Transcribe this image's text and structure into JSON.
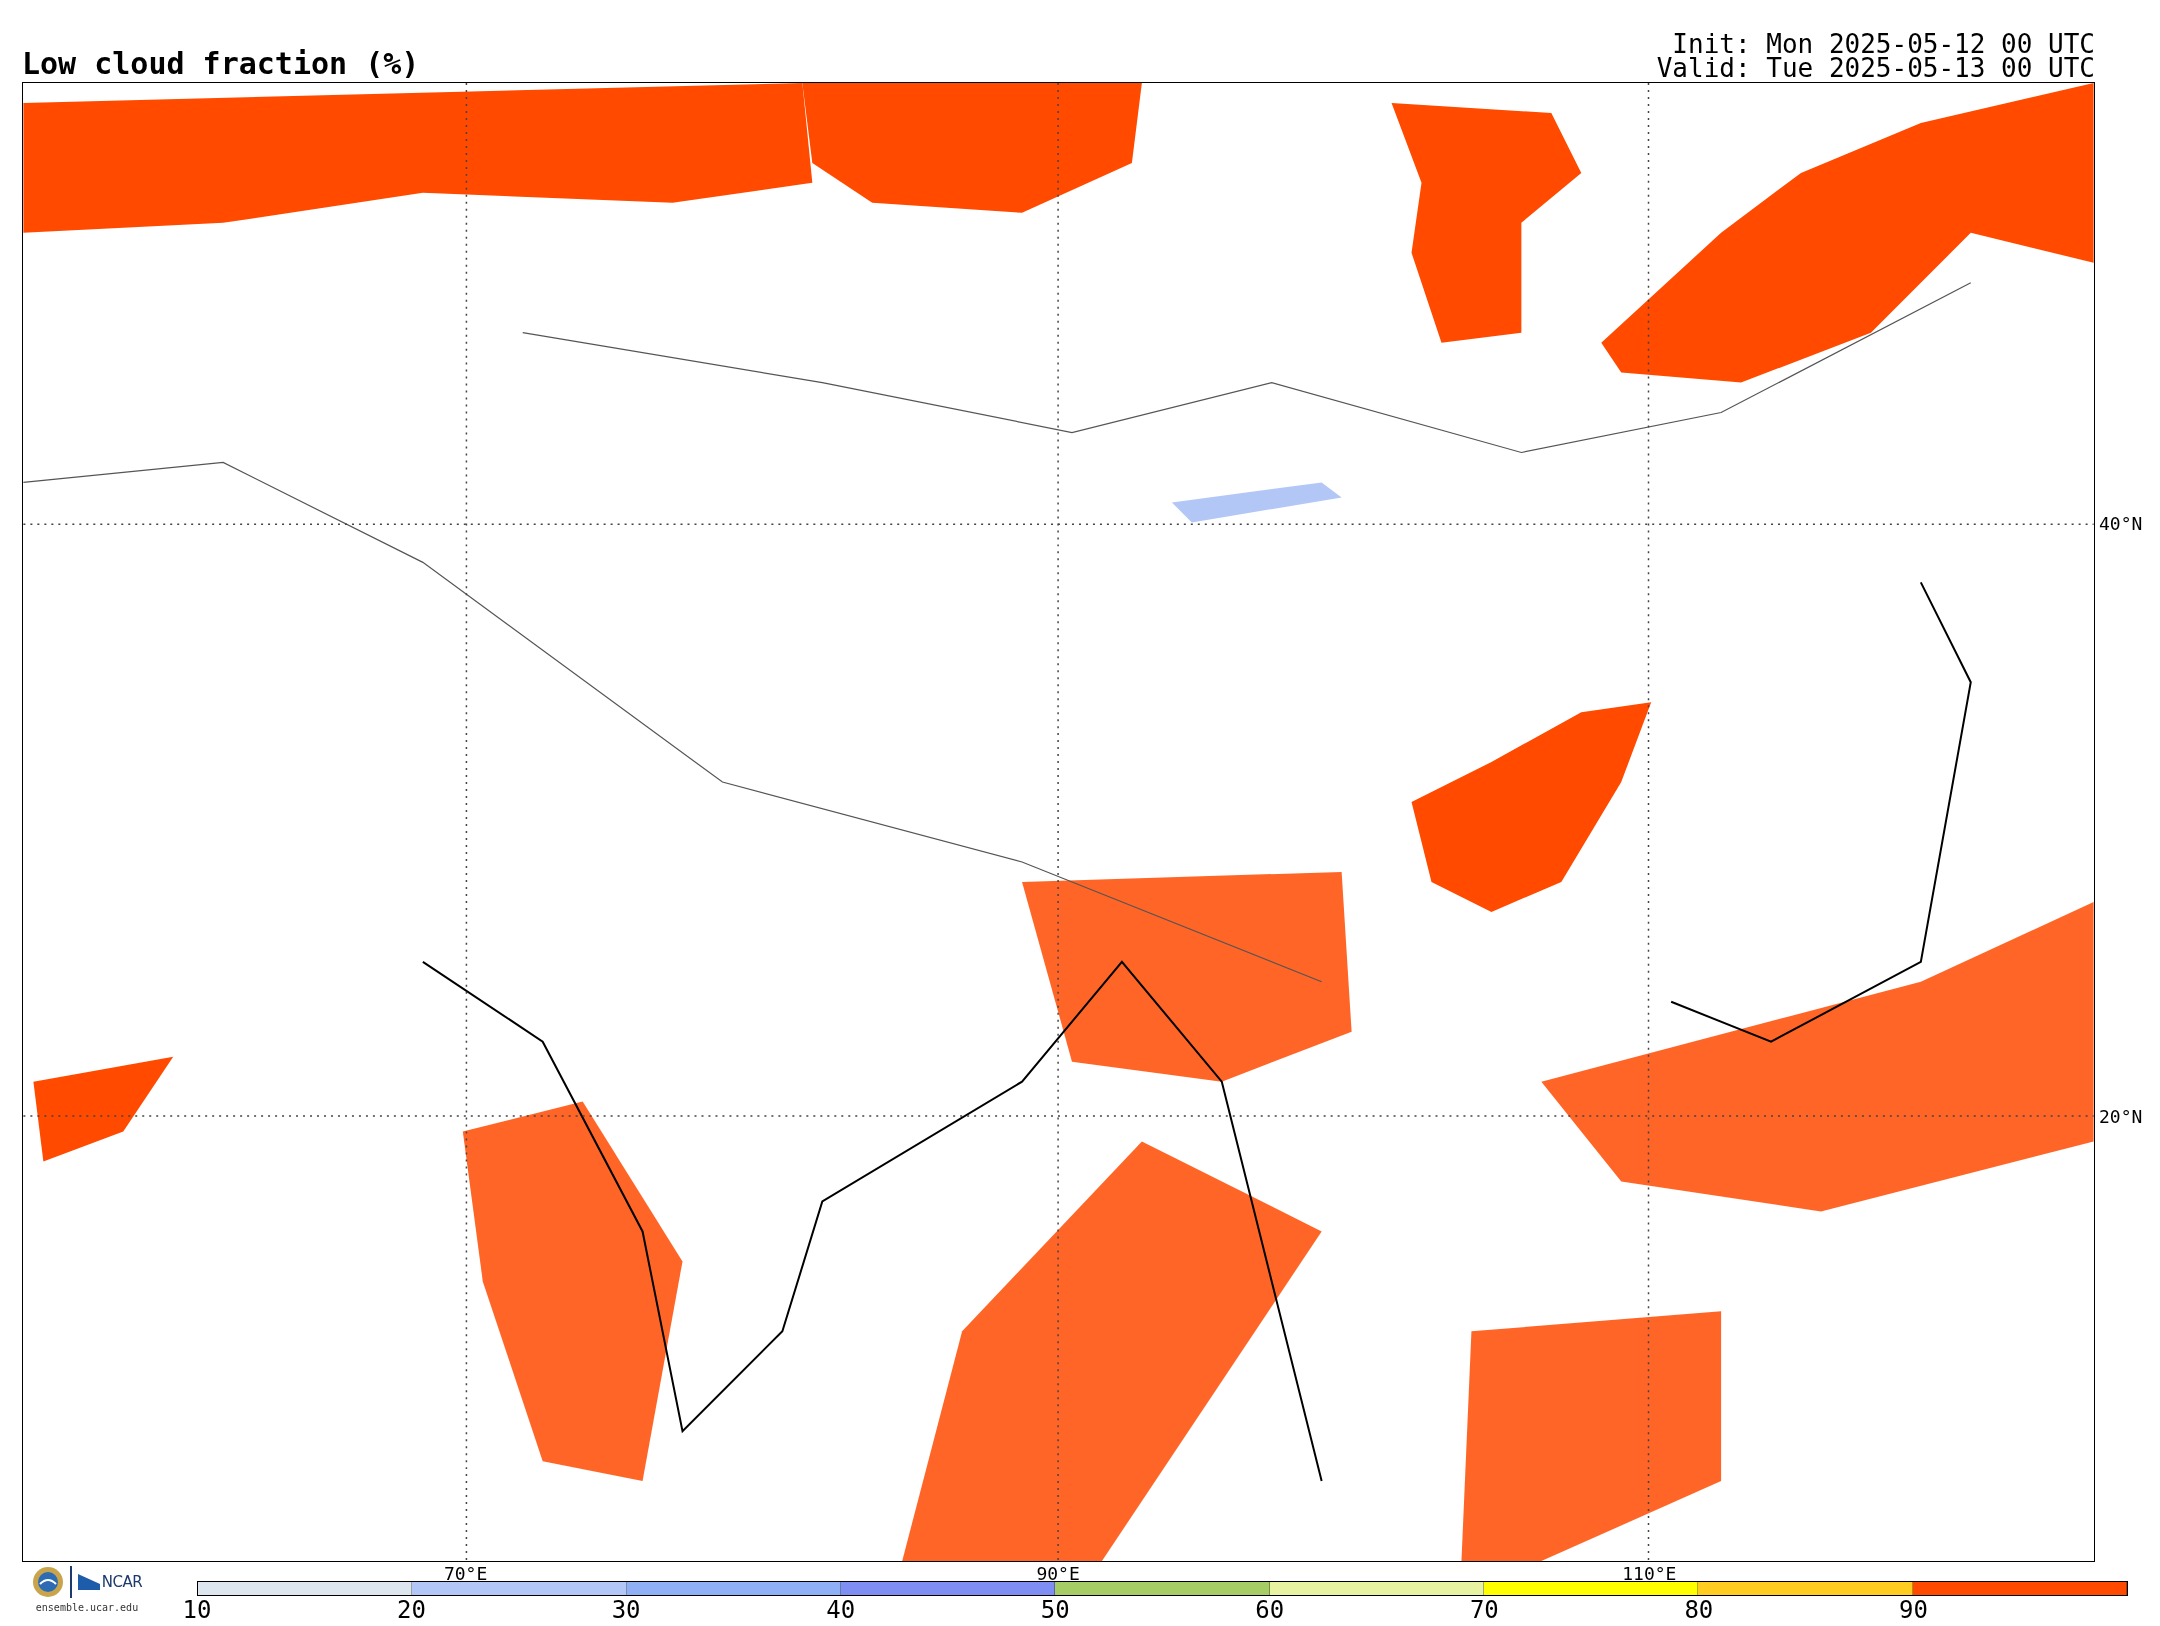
{
  "title": "Low cloud fraction (%)",
  "times": {
    "init": "Init: Mon 2025-05-12 00 UTC",
    "valid": "Valid: Tue 2025-05-13 00 UTC"
  },
  "map": {
    "lat_labels": [
      "40°N",
      "20°N"
    ],
    "lon_labels": [
      "70°E",
      "90°E",
      "110°E"
    ]
  },
  "logos": {
    "ncar": "NCAR",
    "site": "ensemble.ucar.edu"
  },
  "colorbar": {
    "ticks": [
      "10",
      "20",
      "30",
      "40",
      "50",
      "60",
      "70",
      "80",
      "90"
    ],
    "bins": [
      {
        "color": "#dde6ee"
      },
      {
        "color": "#b3c7f7"
      },
      {
        "color": "#8fb0f5"
      },
      {
        "color": "#7e8ef2"
      },
      {
        "color": "#a6cd65"
      },
      {
        "color": "#e7f3a0"
      },
      {
        "color": "#ffff00"
      },
      {
        "color": "#ffcc22"
      },
      {
        "color": "#ff4a00"
      }
    ]
  }
}
